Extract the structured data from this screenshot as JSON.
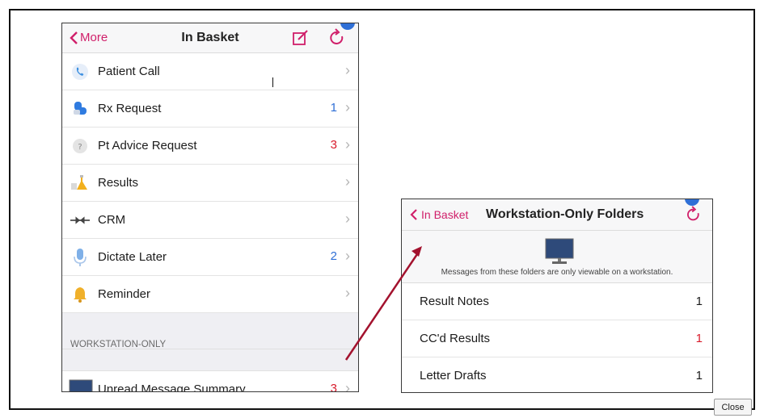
{
  "left_panel": {
    "nav": {
      "back_label": "More",
      "title": "In Basket"
    },
    "items": [
      {
        "label": "Patient Call",
        "count": "",
        "icon": "phone-icon"
      },
      {
        "label": "Rx Request",
        "count": "1",
        "count_color": "#2f6fd6",
        "icon": "pill-icon"
      },
      {
        "label": "Pt Advice Request",
        "count": "3",
        "count_color": "#d81b2b",
        "icon": "question-bubble-icon"
      },
      {
        "label": "Results",
        "count": "",
        "icon": "flask-icon"
      },
      {
        "label": "CRM",
        "count": "",
        "icon": "crm-icon"
      },
      {
        "label": "Dictate Later",
        "count": "2",
        "count_color": "#2f6fd6",
        "icon": "microphone-icon"
      },
      {
        "label": "Reminder",
        "count": "",
        "icon": "bell-icon"
      }
    ],
    "section_header": "WORKSTATION-ONLY",
    "workstation_items": [
      {
        "label": "Unread Message Summary",
        "count": "3",
        "count_color": "#d81b2b",
        "icon": "monitor-icon"
      }
    ]
  },
  "right_panel": {
    "nav": {
      "back_label": "In Basket",
      "title": "Workstation-Only Folders"
    },
    "note": "Messages from these folders are only viewable on a workstation.",
    "items": [
      {
        "label": "Result Notes",
        "count": "1",
        "count_color": "#1c1c1c"
      },
      {
        "label": "CC'd Results",
        "count": "1",
        "count_color": "#d81b2b"
      },
      {
        "label": "Letter Drafts",
        "count": "1",
        "count_color": "#1c1c1c"
      }
    ]
  },
  "close_button": {
    "label": "Close"
  },
  "colors": {
    "accent": "#d01f6a",
    "arrow": "#a3122e",
    "badge_blue": "#2f6fd6",
    "badge_red": "#d81b2b"
  }
}
